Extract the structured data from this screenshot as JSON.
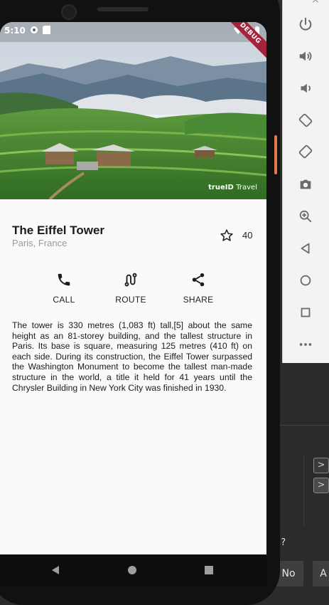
{
  "status": {
    "time": "5:10",
    "debug_label": "DEBUG"
  },
  "hero": {
    "watermark_brand": "trueID",
    "watermark_word": "Travel"
  },
  "place": {
    "title": "The Eiffel Tower",
    "location": "Paris, France",
    "favorite_count": "40"
  },
  "actions": [
    {
      "label": "CALL",
      "icon": "phone-icon"
    },
    {
      "label": "ROUTE",
      "icon": "route-icon"
    },
    {
      "label": "SHARE",
      "icon": "share-icon"
    }
  ],
  "description": "The tower is 330 metres (1,083 ft) tall,[5] about the same height as an 81-storey building, and the tallest structure in Paris. Its base is square, measuring 125 metres (410 ft) on each side. During its construction, the Eiffel Tower surpassed the Washington Monument to become the tallest man-made structure in the world, a title it held for 41 years until the Chrysler Building in New York City was finished in 1930.",
  "emulator_toolbar": {
    "close": "×",
    "items": [
      "power-icon",
      "volume-up-icon",
      "volume-down-icon",
      "rotate-left-icon",
      "rotate-right-icon",
      "camera-icon",
      "zoom-icon",
      "back-icon",
      "home-icon",
      "overview-icon",
      "more-icon"
    ]
  },
  "ide": {
    "question_tail": "?",
    "question_mark": "!",
    "no_button": "No",
    "a_button": "A",
    "arrow": ">"
  },
  "colors": {
    "accent_ribbon": "#a3233a",
    "screen_bg": "#fafafa"
  }
}
